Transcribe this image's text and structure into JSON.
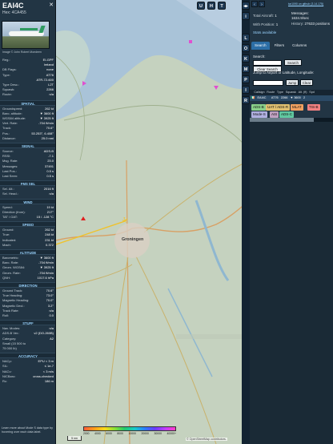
{
  "aircraft": {
    "callsign": "EAI4C",
    "hex_line": "Hex: 4CA455",
    "close": "✕",
    "photo_credit": "Image © John Robert Moedeen"
  },
  "info_rows_top": [
    {
      "k": "Reg.:",
      "v": "EI-GPF"
    },
    {
      "k": "",
      "v": "Ireland"
    },
    {
      "k": "DB Flags:",
      "v": "none"
    },
    {
      "k": "Type:",
      "v": "AT76"
    },
    {
      "k": "",
      "v": "ATR-72-600"
    },
    {
      "k": "Type Desc.:",
      "v": "L2T"
    },
    {
      "k": "Squawk:",
      "v": "2266"
    },
    {
      "k": "Route:",
      "v": "n/a"
    }
  ],
  "sections": [
    {
      "title": "SPATIAL",
      "rows": [
        {
          "k": "Groundspeed:",
          "v": "262 kt"
        },
        {
          "k": "Baro. altitude:",
          "v": "▼ 3600 ft"
        },
        {
          "k": "WGS84 altitude:",
          "v": "▼ 3925 ft"
        },
        {
          "k": "Vert. Rate:",
          "v": "-704 ft/min"
        },
        {
          "k": "Track:",
          "v": "70.6°"
        },
        {
          "k": "Pos.:",
          "v": "53.253°, 6.408°"
        },
        {
          "k": "Distance:",
          "v": "25.0 nmi"
        }
      ]
    },
    {
      "title": "SIGNAL",
      "rows": [
        {
          "k": "Source:",
          "v": "ADS-B"
        },
        {
          "k": "RSSI:",
          "v": "-7.1"
        },
        {
          "k": "Msg. Rate:",
          "v": "23.0"
        },
        {
          "k": "Messages:",
          "v": "37491"
        },
        {
          "k": "Last Pos.:",
          "v": "0.5 s"
        },
        {
          "k": "Last Seen:",
          "v": "0.5 s"
        }
      ]
    },
    {
      "title": "FMS SEL",
      "rows": [
        {
          "k": "Sel. Alt.:",
          "v": "2016 ft"
        },
        {
          "k": "Sel. Head.:",
          "v": "n/a"
        }
      ]
    },
    {
      "title": "WIND",
      "rows": [
        {
          "k": "Speed:",
          "v": "19 kt"
        },
        {
          "k": "Direction (from):",
          "v": "217°"
        },
        {
          "k": "TAT / OAT:",
          "v": "15 / -128 °C"
        }
      ]
    },
    {
      "title": "SPEED",
      "rows": [
        {
          "k": "Ground:",
          "v": "262 kt"
        },
        {
          "k": "True:",
          "v": "248 kt"
        },
        {
          "k": "Indicated:",
          "v": "231 kt"
        },
        {
          "k": "Mach:",
          "v": "0.372"
        }
      ]
    },
    {
      "title": "ALTITUDE",
      "rows": [
        {
          "k": "Barometric:",
          "v": "▼ 3600 ft"
        },
        {
          "k": "Baro. Rate:",
          "v": "-704 ft/min"
        },
        {
          "k": "Geom. WGS84:",
          "v": "▼ 3925 ft"
        },
        {
          "k": "Geom. Rate:",
          "v": "-704 ft/min"
        },
        {
          "k": "QNH:",
          "v": "1017.6 hPa"
        }
      ]
    },
    {
      "title": "DIRECTION",
      "rows": [
        {
          "k": "Ground Track:",
          "v": "70.6°"
        },
        {
          "k": "True Heading:",
          "v": "73.0°"
        },
        {
          "k": "Magnetic Heading:",
          "v": "70.0°"
        },
        {
          "k": "Magnetic Decl.:",
          "v": "3.2°"
        },
        {
          "k": "Track Rate:",
          "v": "n/a"
        },
        {
          "k": "Roll:",
          "v": "0.0"
        }
      ]
    },
    {
      "title": "STUFF",
      "rows": [
        {
          "k": "Nav. Modes:",
          "v": "n/a"
        },
        {
          "k": "ADS-B Ver.:",
          "v": "v2 (DO-260B)"
        },
        {
          "k": "Category:",
          "v": "A2"
        },
        {
          "k": "Small (15 500 to",
          "v": ""
        },
        {
          "k": "75 000 lb)",
          "v": ""
        }
      ]
    },
    {
      "title": "ACCURACY",
      "rows": [
        {
          "k": "NACp:",
          "v": "EPU < 3 m"
        },
        {
          "k": "SIL:",
          "v": "≤ 1e-7"
        },
        {
          "k": "NACv:",
          "v": "< 3 m/s"
        },
        {
          "k": "NICBaro:",
          "v": "cross-checked"
        },
        {
          "k": "Rc:",
          "v": "186 m"
        }
      ]
    }
  ],
  "learn_more": "Learn more about Mode S data type by hovering over each data label.",
  "map": {
    "letters": [
      "U",
      "H",
      "T"
    ],
    "side_buttons": [
      "L",
      "O",
      "K",
      "M",
      "P",
      "I",
      "R"
    ],
    "label_groningen": "Groningen",
    "attribution": "© OpenStreetMap contributors.",
    "scale": "5 nm",
    "altitude_labels": [
      "2000",
      "4000",
      "6000",
      "8000",
      "10000",
      "20000",
      "30000",
      "40000+"
    ],
    "zoom_in": "+",
    "zoom_out": "−"
  },
  "sidebar": {
    "version": "tar1090 on github (3.14.175)",
    "total_aircraft_label": "Total Aircraft:",
    "total_aircraft": "1",
    "messages_label": "Messages:",
    "messages": "1634.9/sec",
    "with_pos_label": "With Position:",
    "with_pos": "1",
    "history_label": "History:",
    "history": "27633 positions",
    "stats_label": "Stats available",
    "tabs": [
      "Search",
      "Filters",
      "Columns"
    ],
    "search_label": "Search:",
    "search_btn": "Search",
    "clear_search": "Clear Search",
    "jump_label": "Jump to Airport or Latitude, Longitude:",
    "jump_btn": "Jump",
    "clear_btn": "Clear",
    "table_headers": [
      "",
      "Callsign",
      "Route",
      "Type",
      "Squawk",
      "Alt. (ft)",
      "Spd"
    ],
    "table_row": [
      "🇮🇪",
      "EAI4C",
      "",
      "AT76",
      "2266",
      "▼ 3600",
      "2"
    ],
    "badges": [
      {
        "t": "ADS-B",
        "c": "#8ad08a"
      },
      {
        "t": "UAT / ADS-R",
        "c": "#e0c070"
      },
      {
        "t": "MLAT",
        "c": "#f0a060"
      },
      {
        "t": "TIS-B",
        "c": "#f08080"
      },
      {
        "t": "Mode-S",
        "c": "#b0b0e0"
      },
      {
        "t": "AIS",
        "c": "#c0a0c0"
      },
      {
        "t": "ADS-C",
        "c": "#60c8a0"
      }
    ]
  },
  "colors": {
    "panel": "#223544",
    "accent": "#9ad4ff",
    "track": "#f0c22a"
  }
}
